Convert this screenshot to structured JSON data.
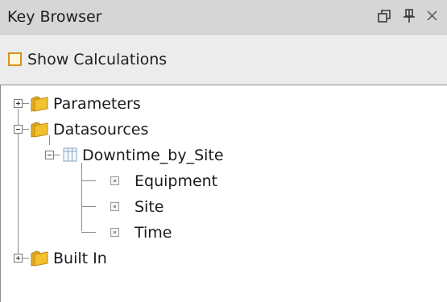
{
  "panel": {
    "title": "Key Browser",
    "icons": [
      "restore-window-icon",
      "pin-icon",
      "close-icon"
    ]
  },
  "toolbar": {
    "show_calculations_label": "Show Calculations",
    "show_calculations_checked": false
  },
  "tree": {
    "parameters": "Parameters",
    "datasources": "Datasources",
    "datasource_name": "Downtime_by_Site",
    "columns": [
      "Equipment",
      "Site",
      "Time"
    ],
    "built_in": "Built In"
  },
  "colors": {
    "folder": "#f2c12e",
    "checkbox_border": "#d8931a",
    "title_bar": "#d6d6d6"
  }
}
